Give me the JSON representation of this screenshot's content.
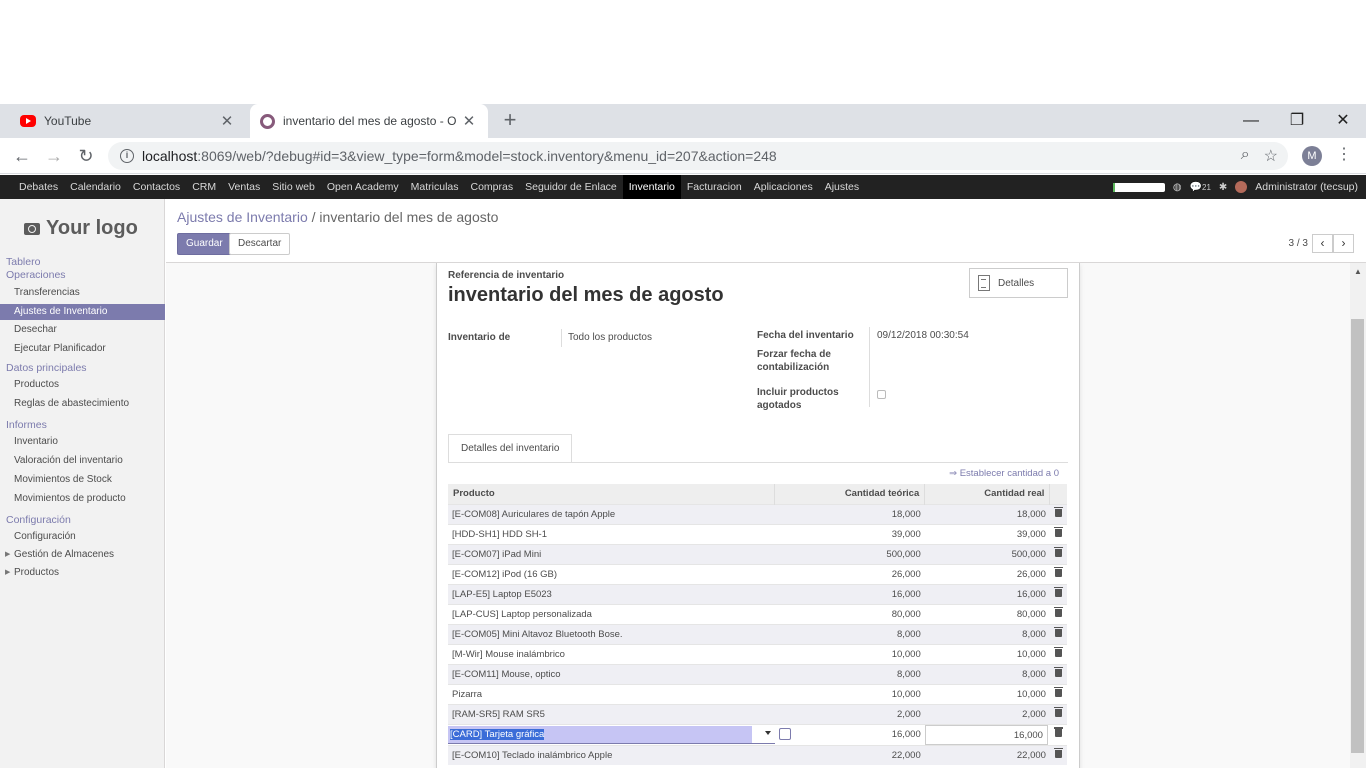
{
  "browser": {
    "tabs": [
      {
        "title": "YouTube"
      },
      {
        "title": "inventario del mes de agosto - O"
      }
    ],
    "url_host": "localhost",
    "url_rest": ":8069/web/?debug#id=3&view_type=form&model=stock.inventory&menu_id=207&action=248",
    "profile_initial": "M"
  },
  "topmenu": {
    "items": [
      "Debates",
      "Calendario",
      "Contactos",
      "CRM",
      "Ventas",
      "Sitio web",
      "Open Academy",
      "Matriculas",
      "Compras",
      "Seguidor de Enlace",
      "Inventario",
      "Facturacion",
      "Aplicaciones",
      "Ajustes"
    ],
    "active_index": 10,
    "badge": "21",
    "user": "Administrator (tecsup)",
    "progress_fraction": 0.04
  },
  "sidebar": {
    "logo_text": "Your logo",
    "heads": {
      "tablero": "Tablero",
      "operaciones": "Operaciones",
      "datos": "Datos principales",
      "informes": "Informes",
      "config": "Configuración"
    },
    "items": {
      "transferencias": "Transferencias",
      "ajustes": "Ajustes de Inventario",
      "desechar": "Desechar",
      "planificador": "Ejecutar Planificador",
      "productos": "Productos",
      "reglas": "Reglas de abastecimiento",
      "inventario": "Inventario",
      "valoracion": "Valoración del inventario",
      "mov_stock": "Movimientos de Stock",
      "mov_producto": "Movimientos de producto",
      "configuracion": "Configuración",
      "almacenes": "Gestión de Almacenes",
      "productos2": "Productos"
    }
  },
  "control": {
    "breadcrumb_parent": "Ajustes de Inventario",
    "breadcrumb_sep": "/",
    "breadcrumb_current": "inventario del mes de agosto",
    "save": "Guardar",
    "discard": "Descartar",
    "pager": "3 / 3"
  },
  "form": {
    "ref_label": "Referencia de inventario",
    "title": "inventario del mes de agosto",
    "details_button": "Detalles",
    "inventario_de_label": "Inventario de",
    "inventario_de_value": "Todo los productos",
    "fecha_label": "Fecha del inventario",
    "fecha_value": "09/12/2018 00:30:54",
    "forzar_label_1": "Forzar fecha de",
    "forzar_label_2": "contabilización",
    "incluir_label_1": "Incluir productos",
    "incluir_label_2": "agotados",
    "incluir_checked": false,
    "tab_label": "Detalles del inventario",
    "set_zero": "⇒ Establecer cantidad a 0"
  },
  "lines": {
    "headers": {
      "product": "Producto",
      "theoretical": "Cantidad teórica",
      "real": "Cantidad real"
    },
    "rows": [
      {
        "product": "[E-COM08] Auriculares de tapón Apple",
        "theoretical": "18,000",
        "real": "18,000"
      },
      {
        "product": "[HDD-SH1] HDD SH-1",
        "theoretical": "39,000",
        "real": "39,000"
      },
      {
        "product": "[E-COM07] iPad Mini",
        "theoretical": "500,000",
        "real": "500,000"
      },
      {
        "product": "[E-COM12] iPod (16 GB)",
        "theoretical": "26,000",
        "real": "26,000"
      },
      {
        "product": "[LAP-E5] Laptop E5023",
        "theoretical": "16,000",
        "real": "16,000"
      },
      {
        "product": "[LAP-CUS] Laptop personalizada",
        "theoretical": "80,000",
        "real": "80,000"
      },
      {
        "product": "[E-COM05] Mini Altavoz Bluetooth Bose.",
        "theoretical": "8,000",
        "real": "8,000"
      },
      {
        "product": "[M-Wir] Mouse inalámbrico",
        "theoretical": "10,000",
        "real": "10,000"
      },
      {
        "product": "[E-COM11] Mouse, optico",
        "theoretical": "8,000",
        "real": "8,000"
      },
      {
        "product": "Pizarra",
        "theoretical": "10,000",
        "real": "10,000"
      },
      {
        "product": "[RAM-SR5] RAM SR5",
        "theoretical": "2,000",
        "real": "2,000"
      }
    ],
    "editing": {
      "product": "[CARD] Tarjeta gráfica",
      "theoretical": "16,000",
      "real": "16,000"
    },
    "last": {
      "product": "[E-COM10] Teclado inalámbrico Apple",
      "theoretical": "22,000",
      "real": "22,000"
    }
  }
}
